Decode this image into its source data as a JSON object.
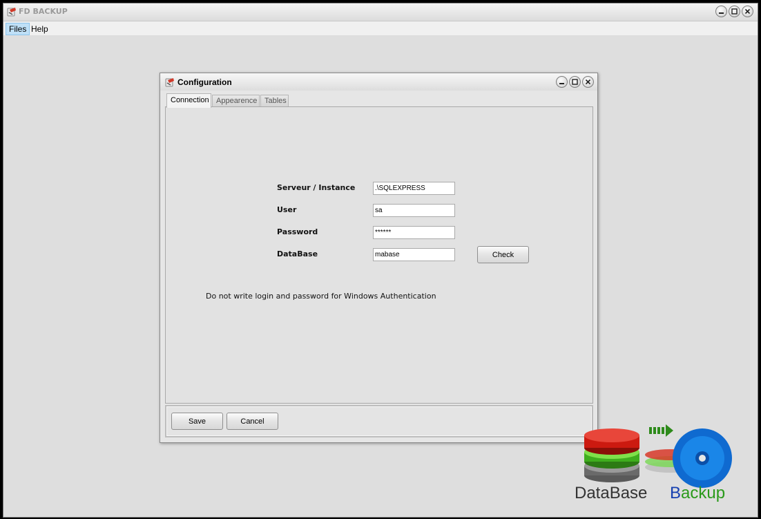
{
  "window": {
    "title": "FD BACKUP",
    "icon": "app-logo-icon"
  },
  "menubar": {
    "items": [
      {
        "label": "Files"
      },
      {
        "label": "Help"
      }
    ]
  },
  "dialog": {
    "title": "Configuration",
    "icon": "app-logo-icon",
    "tabs": [
      {
        "label": "Connection"
      },
      {
        "label": "Appearence"
      },
      {
        "label": "Tables"
      }
    ],
    "fields": {
      "server": {
        "label": "Serveur / Instance",
        "value": ".\\SQLEXPRESS"
      },
      "user": {
        "label": "User",
        "value": "sa"
      },
      "password": {
        "label": "Password",
        "value": "******"
      },
      "database": {
        "label": "DataBase",
        "value": "mabase"
      }
    },
    "check_label": "Check",
    "note": "Do not write login and password for Windows Authentication",
    "save_label": "Save",
    "cancel_label": "Cancel"
  },
  "logo": {
    "left_word": "DataBase",
    "right_word": "Backup",
    "colors": {
      "red": "#cc1a10",
      "green": "#3fae1e",
      "blue": "#1478d4",
      "arrow": "#2d8a1a",
      "text_dark": "#333333",
      "text_blue": "#1740b0",
      "text_green": "#2a9a1a"
    }
  }
}
